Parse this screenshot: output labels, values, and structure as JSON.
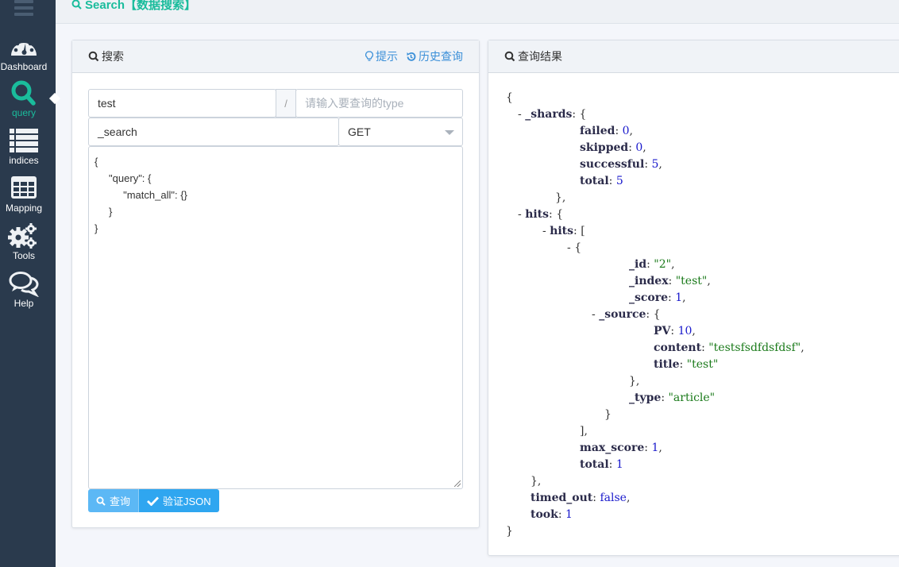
{
  "sidebar": {
    "items": [
      {
        "label": "Dashboard",
        "icon": "dashboard-icon",
        "active": false
      },
      {
        "label": "query",
        "icon": "search-icon",
        "active": true
      },
      {
        "label": "indices",
        "icon": "list-icon",
        "active": false
      },
      {
        "label": "Mapping",
        "icon": "table-icon",
        "active": false
      },
      {
        "label": "Tools",
        "icon": "gears-icon",
        "active": false
      },
      {
        "label": "Help",
        "icon": "chat-icon",
        "active": false
      }
    ]
  },
  "topbar": {
    "title": "Search【数据搜索】"
  },
  "search_panel": {
    "title": "搜索",
    "hint_link": "提示",
    "history_link": "历史查询",
    "index_value": "test",
    "separator": "/",
    "type_placeholder": "请输入要查询的type",
    "endpoint_value": "_search",
    "method_selected": "GET",
    "body": "{\n     \"query\": {\n          \"match_all\": {}\n     }\n}",
    "query_button": "查询",
    "validate_button": "验证JSON"
  },
  "result_panel": {
    "title": "查询结果",
    "lines": [
      {
        "indent": 0,
        "toggle": "",
        "parts": [
          {
            "t": "p",
            "v": "{"
          }
        ]
      },
      {
        "indent": 1,
        "toggle": "- ",
        "parts": [
          {
            "t": "k",
            "v": "_shards"
          },
          {
            "t": "p",
            "v": ": {"
          }
        ]
      },
      {
        "indent": 3,
        "toggle": "",
        "parts": [
          {
            "t": "k",
            "v": "failed"
          },
          {
            "t": "p",
            "v": ": "
          },
          {
            "t": "n",
            "v": "0"
          },
          {
            "t": "p",
            "v": ","
          }
        ]
      },
      {
        "indent": 3,
        "toggle": "",
        "parts": [
          {
            "t": "k",
            "v": "skipped"
          },
          {
            "t": "p",
            "v": ": "
          },
          {
            "t": "n",
            "v": "0"
          },
          {
            "t": "p",
            "v": ","
          }
        ]
      },
      {
        "indent": 3,
        "toggle": "",
        "parts": [
          {
            "t": "k",
            "v": "successful"
          },
          {
            "t": "p",
            "v": ": "
          },
          {
            "t": "n",
            "v": "5"
          },
          {
            "t": "p",
            "v": ","
          }
        ]
      },
      {
        "indent": 3,
        "toggle": "",
        "parts": [
          {
            "t": "k",
            "v": "total"
          },
          {
            "t": "p",
            "v": ": "
          },
          {
            "t": "n",
            "v": "5"
          }
        ]
      },
      {
        "indent": 2,
        "toggle": "",
        "parts": [
          {
            "t": "p",
            "v": "},"
          }
        ]
      },
      {
        "indent": 1,
        "toggle": "- ",
        "parts": [
          {
            "t": "k",
            "v": "hits"
          },
          {
            "t": "p",
            "v": ": {"
          }
        ]
      },
      {
        "indent": 2,
        "toggle": "- ",
        "parts": [
          {
            "t": "k",
            "v": "hits"
          },
          {
            "t": "p",
            "v": ": ["
          }
        ]
      },
      {
        "indent": 3,
        "toggle": "- ",
        "parts": [
          {
            "t": "p",
            "v": "{"
          }
        ]
      },
      {
        "indent": 5,
        "toggle": "",
        "parts": [
          {
            "t": "k",
            "v": "_id"
          },
          {
            "t": "p",
            "v": ": "
          },
          {
            "t": "s",
            "v": "\"2\""
          },
          {
            "t": "p",
            "v": ","
          }
        ]
      },
      {
        "indent": 5,
        "toggle": "",
        "parts": [
          {
            "t": "k",
            "v": "_index"
          },
          {
            "t": "p",
            "v": ": "
          },
          {
            "t": "s",
            "v": "\"test\""
          },
          {
            "t": "p",
            "v": ","
          }
        ]
      },
      {
        "indent": 5,
        "toggle": "",
        "parts": [
          {
            "t": "k",
            "v": "_score"
          },
          {
            "t": "p",
            "v": ": "
          },
          {
            "t": "n",
            "v": "1"
          },
          {
            "t": "p",
            "v": ","
          }
        ]
      },
      {
        "indent": 4,
        "toggle": "- ",
        "parts": [
          {
            "t": "k",
            "v": "_source"
          },
          {
            "t": "p",
            "v": ": {"
          }
        ]
      },
      {
        "indent": 6,
        "toggle": "",
        "parts": [
          {
            "t": "k",
            "v": "PV"
          },
          {
            "t": "p",
            "v": ": "
          },
          {
            "t": "n",
            "v": "10"
          },
          {
            "t": "p",
            "v": ","
          }
        ]
      },
      {
        "indent": 6,
        "toggle": "",
        "parts": [
          {
            "t": "k",
            "v": "content"
          },
          {
            "t": "p",
            "v": ": "
          },
          {
            "t": "s",
            "v": "\"testsfsdfdsfdsf\""
          },
          {
            "t": "p",
            "v": ","
          }
        ]
      },
      {
        "indent": 6,
        "toggle": "",
        "parts": [
          {
            "t": "k",
            "v": "title"
          },
          {
            "t": "p",
            "v": ": "
          },
          {
            "t": "s",
            "v": "\"test\""
          }
        ]
      },
      {
        "indent": 5,
        "toggle": "",
        "parts": [
          {
            "t": "p",
            "v": "},"
          }
        ]
      },
      {
        "indent": 5,
        "toggle": "",
        "parts": [
          {
            "t": "k",
            "v": "_type"
          },
          {
            "t": "p",
            "v": ": "
          },
          {
            "t": "s",
            "v": "\"article\""
          }
        ]
      },
      {
        "indent": 4,
        "toggle": "",
        "parts": [
          {
            "t": "p",
            "v": "}"
          }
        ]
      },
      {
        "indent": 3,
        "toggle": "",
        "parts": [
          {
            "t": "p",
            "v": "],"
          }
        ]
      },
      {
        "indent": 3,
        "toggle": "",
        "parts": [
          {
            "t": "k",
            "v": "max_score"
          },
          {
            "t": "p",
            "v": ": "
          },
          {
            "t": "n",
            "v": "1"
          },
          {
            "t": "p",
            "v": ","
          }
        ]
      },
      {
        "indent": 3,
        "toggle": "",
        "parts": [
          {
            "t": "k",
            "v": "total"
          },
          {
            "t": "p",
            "v": ": "
          },
          {
            "t": "n",
            "v": "1"
          }
        ]
      },
      {
        "indent": 1,
        "toggle": "",
        "parts": [
          {
            "t": "p",
            "v": "},"
          }
        ]
      },
      {
        "indent": 1,
        "toggle": "",
        "parts": [
          {
            "t": "k",
            "v": "timed_out"
          },
          {
            "t": "p",
            "v": ": "
          },
          {
            "t": "b",
            "v": "false"
          },
          {
            "t": "p",
            "v": ","
          }
        ]
      },
      {
        "indent": 1,
        "toggle": "",
        "parts": [
          {
            "t": "k",
            "v": "took"
          },
          {
            "t": "p",
            "v": ": "
          },
          {
            "t": "n",
            "v": "1"
          }
        ]
      },
      {
        "indent": 0,
        "toggle": "",
        "parts": [
          {
            "t": "p",
            "v": "}"
          }
        ]
      }
    ]
  },
  "colors": {
    "accent": "#1abc9c",
    "link": "#3a8fd8",
    "sidebar_bg": "#2a3a4d",
    "button_primary": "#2fa6f0"
  }
}
